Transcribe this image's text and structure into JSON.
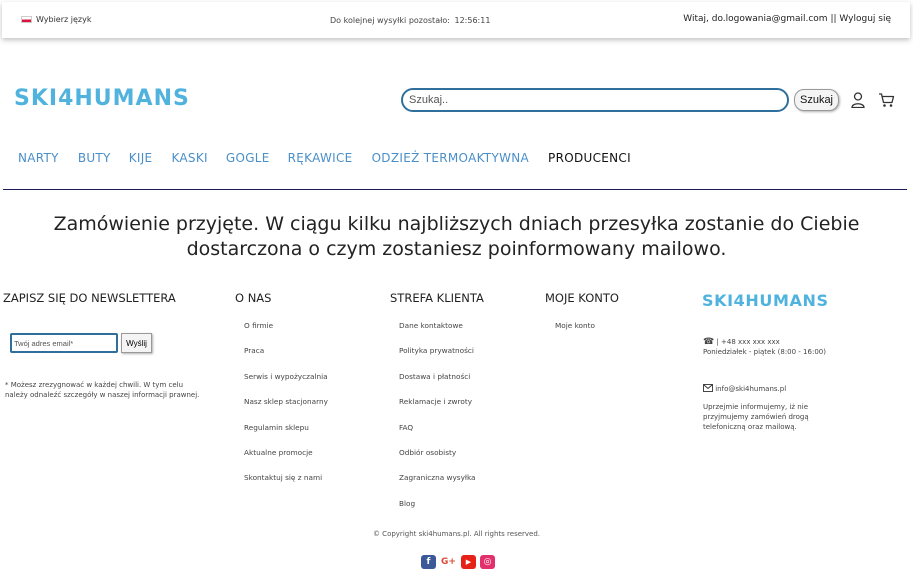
{
  "topbar": {
    "language_label": "Wybierz język",
    "shipping_text": "Do kolejnej wysyłki pozostało:",
    "shipping_timer": "12:56:11",
    "greeting": "Witaj, do.logowania@gmail.com",
    "separator": "||",
    "logout_label": "Wyloguj się"
  },
  "header": {
    "logo_text": "SKI4HUMANS",
    "search_placeholder": "Szukaj..",
    "search_button": "Szukaj",
    "user_icon": "user-icon",
    "cart_icon": "cart-icon"
  },
  "nav": {
    "items": [
      {
        "label": "NARTY"
      },
      {
        "label": "BUTY"
      },
      {
        "label": "KIJE"
      },
      {
        "label": "KASKI"
      },
      {
        "label": "GOGLE"
      },
      {
        "label": "RĘKAWICE"
      },
      {
        "label": "ODZIEŻ TERMOAKTYWNA"
      },
      {
        "label": "PRODUCENCI"
      }
    ]
  },
  "main": {
    "message": "Zamówienie przyjęte. W ciągu kilku najbliższych dniach przesyłka zostanie do Ciebie dostarczona o czym zostaniesz poinformowany mailowo."
  },
  "footer": {
    "newsletter": {
      "title": "ZAPISZ SIĘ DO NEWSLETTERA",
      "email_placeholder": "Twój adres email*",
      "send_button": "Wyślij",
      "note": "* Możesz zrezygnować w każdej chwili. W tym celu należy odnaleźć szczegóły w naszej informacji prawnej."
    },
    "about": {
      "title": "O NAS",
      "links": [
        "O firmie",
        "Praca",
        "Serwis i wypożyczalnia",
        "Nasz sklep stacjonarny",
        "Regulamin sklepu",
        "Aktualne promocje",
        "Skontaktuj się z nami"
      ]
    },
    "client": {
      "title": "STREFA KLIENTA",
      "links": [
        "Dane kontaktowe",
        "Polityka prywatności",
        "Dostawa i płatności",
        "Reklamacje i zwroty",
        "FAQ",
        "Odbiór osobisty",
        "Zagraniczna wysyłka",
        "Blog"
      ]
    },
    "account": {
      "title": "MOJE KONTO",
      "links": [
        "Moje konto"
      ]
    },
    "contact": {
      "logo_text": "SKI4HUMANS",
      "phone": "| +48 xxx xxx xxx",
      "hours": "Poniedziałek - piątek (8:00 - 16:00)",
      "email": "info@ski4humans.pl",
      "info": "Uprzejmie informujemy, iż nie przyjmujemy zamówień drogą telefoniczną oraz mailową."
    },
    "copyright": "© Copyright ski4humans.pl. All rights reserved.",
    "social": [
      {
        "icon": "facebook-icon",
        "glyph": "f",
        "color": "#3b5998"
      },
      {
        "icon": "google-plus-icon",
        "glyph": "G+",
        "color": "#dd4b39"
      },
      {
        "icon": "youtube-icon",
        "glyph": "▶",
        "color": "#e62117"
      },
      {
        "icon": "instagram-icon",
        "glyph": "◎",
        "color": "#e1306c"
      }
    ]
  }
}
